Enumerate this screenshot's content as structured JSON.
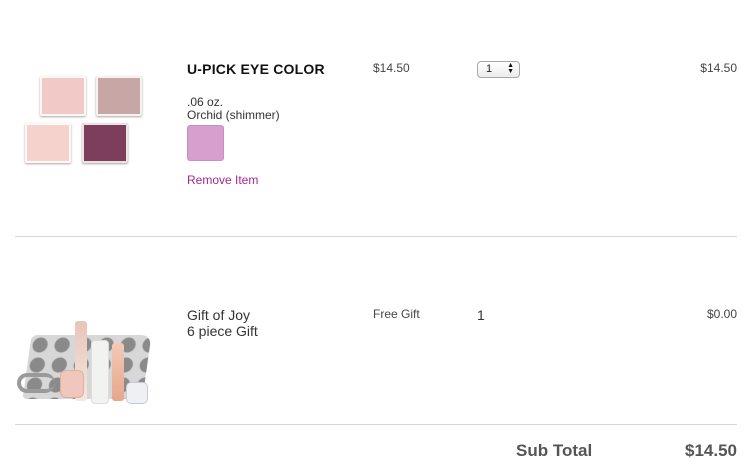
{
  "cart": {
    "items": [
      {
        "name": "U-PICK EYE COLOR",
        "size": ".06 oz.",
        "shade": "Orchid (shimmer)",
        "swatch_color": "#d69fce",
        "remove_label": "Remove Item",
        "price": "$14.50",
        "quantity": "1",
        "total": "$14.50",
        "image_icon": "eye-shadow-palette-image"
      },
      {
        "name_line1": "Gift of Joy",
        "name_line2": "6 piece Gift",
        "price": "Free Gift",
        "quantity": "1",
        "total": "$0.00",
        "image_icon": "gift-set-bag-image"
      }
    ]
  },
  "summary": {
    "subtotal_label": "Sub Total",
    "subtotal_value": "$14.50"
  },
  "colors": {
    "remove_link": "#a4268c",
    "divider": "#d6d6d6"
  }
}
